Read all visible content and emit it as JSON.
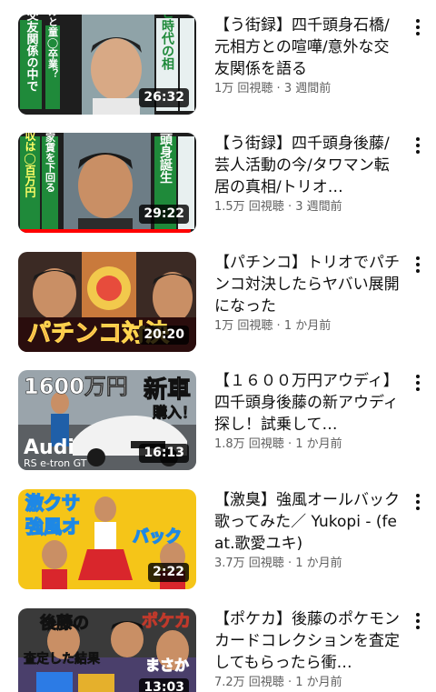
{
  "videos": [
    {
      "title": "【う街録】四千頭身石橋/元相方との喧嘩/意外な交友関係を語る",
      "views": "1万 回視聴",
      "age": "3 週間前",
      "duration": "26:32",
      "thumb_text_1": "コンビ時代の相",
      "thumb_text_2": "広がる交友関係の中で",
      "thumb_text_3": "モデルと童◯卒業？",
      "progress": 0.0,
      "accent": "#1f8a3a"
    },
    {
      "title": "【う街録】四千頭身後藤/芸人活動の今/タワマン転居の真相/トリオ…",
      "views": "1.5万 回視聴",
      "age": "3 週間前",
      "duration": "29:22",
      "thumb_text_1": "四千頭身誕生",
      "thumb_text_2": "最高月収は◯百万円",
      "thumb_text_3": "月収が家賃を下回る",
      "progress": 0.97,
      "accent": "#1f8a3a"
    },
    {
      "title": "【パチンコ】トリオでパチンコ対決したらヤバい展開になった",
      "views": "1万 回視聴",
      "age": "1 か月前",
      "duration": "20:20",
      "thumb_text_1": "パチンコ対決",
      "progress": 0.0,
      "accent": "#c0392b"
    },
    {
      "title": "【１６００万円アウディ】四千頭身後藤の新アウディ探し！試乗して…",
      "views": "1.8万 回視聴",
      "age": "1 か月前",
      "duration": "16:13",
      "thumb_text_1": "1600万円",
      "thumb_text_2": "新車",
      "thumb_text_3": "購入！",
      "thumb_text_4": "Audi",
      "thumb_text_5": "RS e-tron GT",
      "progress": 0.0,
      "accent": "#2c3e50"
    },
    {
      "title": "【激臭】強風オールバック歌ってみた／ Yukopi - (feat.歌愛ユキ)",
      "views": "3.7万 回視聴",
      "age": "1 か月前",
      "duration": "2:22",
      "thumb_text_1": "激クサ",
      "thumb_text_2": "強風オ",
      "thumb_text_3": "バック",
      "progress": 0.0,
      "accent": "#f5c518"
    },
    {
      "title": "【ポケカ】後藤のポケモンカードコレクションを査定してもらったら衝…",
      "views": "7.2万 回視聴",
      "age": "1 か月前",
      "duration": "13:03",
      "thumb_text_1": "後藤の",
      "thumb_text_2": "ポケカ",
      "thumb_text_3": "査定した結果",
      "thumb_text_4": "まさか",
      "progress": 0.0,
      "accent": "#e67e22"
    }
  ]
}
